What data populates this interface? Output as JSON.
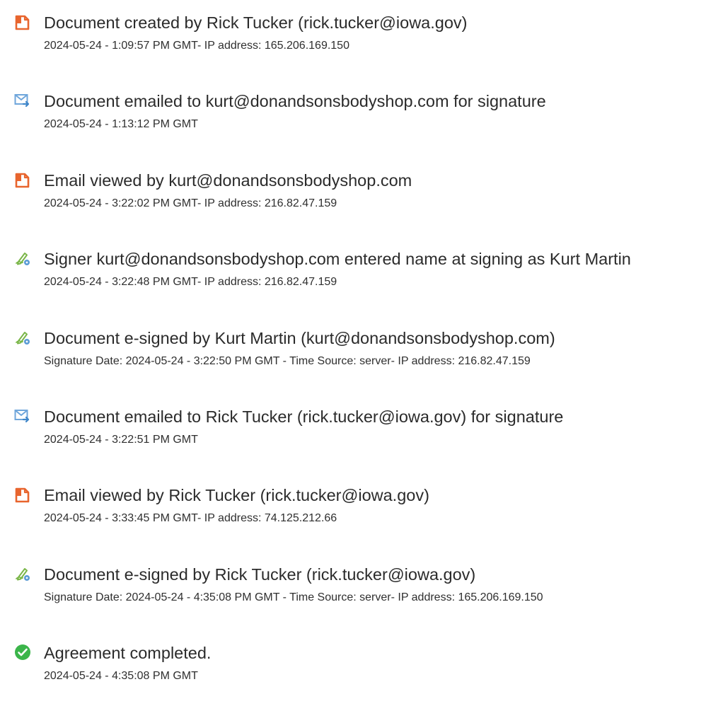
{
  "colors": {
    "document_icon": "#E8652E",
    "email_icon": "#6FA6DB",
    "sign_icon": "#7AB648",
    "complete_icon": "#3BB54A"
  },
  "events": [
    {
      "icon": "document-icon",
      "title": "Document created by Rick Tucker (rick.tucker@iowa.gov)",
      "detail": "2024-05-24 - 1:09:57 PM GMT- IP address: 165.206.169.150"
    },
    {
      "icon": "email-icon",
      "title": "Document emailed to kurt@donandsonsbodyshop.com for signature",
      "detail": "2024-05-24 - 1:13:12 PM GMT"
    },
    {
      "icon": "document-icon",
      "title": "Email viewed by kurt@donandsonsbodyshop.com",
      "detail": "2024-05-24 - 3:22:02 PM GMT- IP address: 216.82.47.159"
    },
    {
      "icon": "sign-icon",
      "title": "Signer kurt@donandsonsbodyshop.com entered name at signing as Kurt Martin",
      "detail": "2024-05-24 - 3:22:48 PM GMT- IP address: 216.82.47.159"
    },
    {
      "icon": "sign-icon",
      "title": "Document e-signed by Kurt Martin (kurt@donandsonsbodyshop.com)",
      "detail": "Signature Date: 2024-05-24 - 3:22:50 PM GMT - Time Source: server- IP address: 216.82.47.159"
    },
    {
      "icon": "email-icon",
      "title": "Document emailed to Rick Tucker (rick.tucker@iowa.gov) for signature",
      "detail": "2024-05-24 - 3:22:51 PM GMT"
    },
    {
      "icon": "document-icon",
      "title": "Email viewed by Rick Tucker (rick.tucker@iowa.gov)",
      "detail": "2024-05-24 - 3:33:45 PM GMT- IP address: 74.125.212.66"
    },
    {
      "icon": "sign-icon",
      "title": "Document e-signed by Rick Tucker (rick.tucker@iowa.gov)",
      "detail": "Signature Date: 2024-05-24 - 4:35:08 PM GMT - Time Source: server- IP address: 165.206.169.150"
    },
    {
      "icon": "check-circle-icon",
      "title": "Agreement completed.",
      "detail": "2024-05-24 - 4:35:08 PM GMT"
    }
  ]
}
